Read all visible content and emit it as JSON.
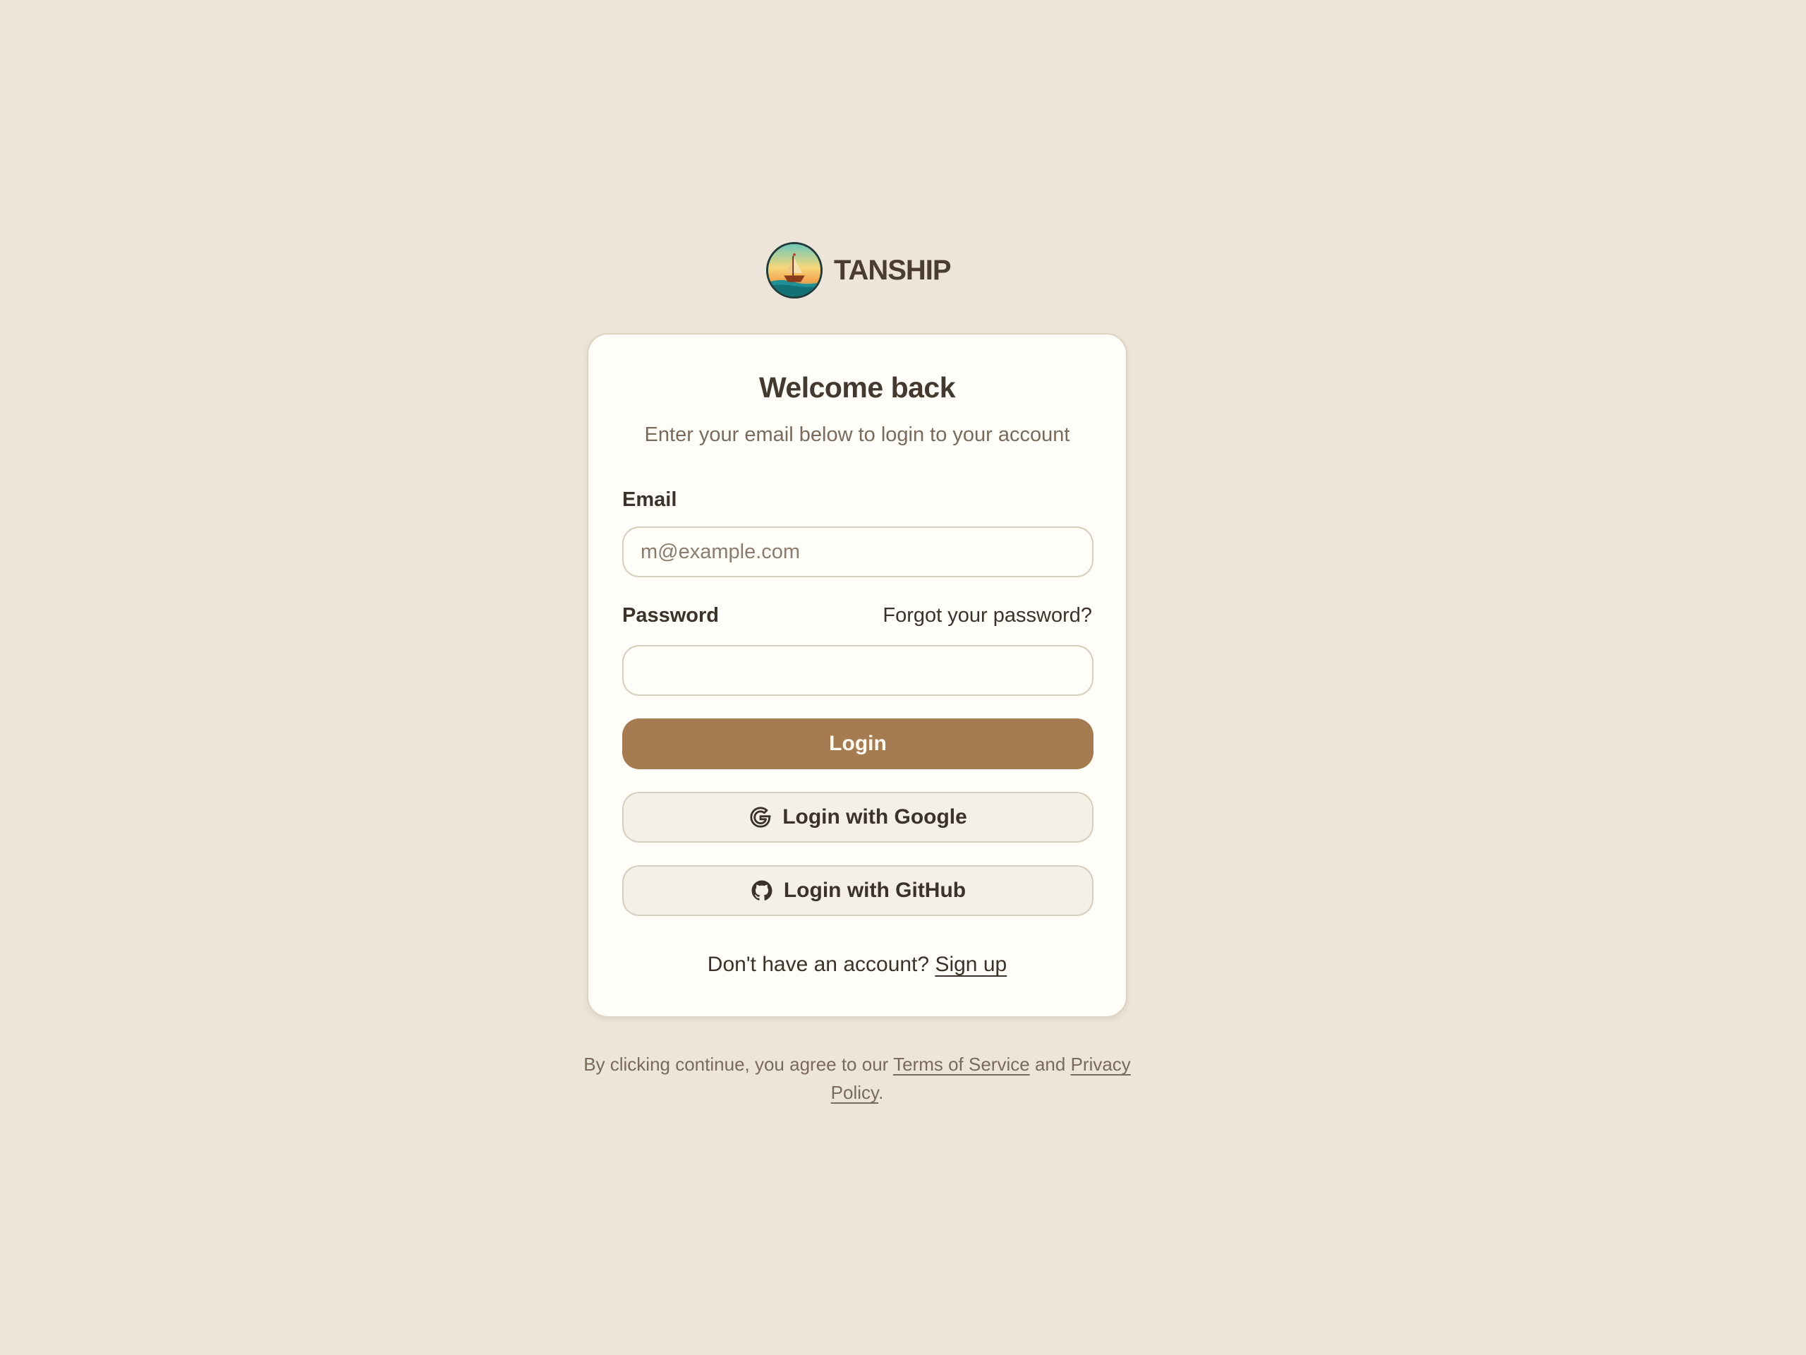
{
  "brand": {
    "name": "TANSHIP",
    "logo_icon": "ship-logo-icon"
  },
  "card": {
    "title": "Welcome back",
    "subtitle": "Enter your email below to login to your account"
  },
  "form": {
    "email_label": "Email",
    "email_placeholder": "m@example.com",
    "email_value": "",
    "password_label": "Password",
    "password_value": "",
    "forgot_link": "Forgot your password?",
    "login_button": "Login",
    "google_button": "Login with Google",
    "google_icon": "google-icon",
    "github_button": "Login with GitHub",
    "github_icon": "github-icon"
  },
  "signup": {
    "prompt": "Don't have an account?",
    "link": "Sign up"
  },
  "legal": {
    "prefix": "By clicking continue, you agree to our",
    "terms_link": "Terms of Service",
    "and": "and",
    "privacy_link": "Privacy Policy",
    "suffix": "."
  },
  "colors": {
    "background": "#ede5d9",
    "card": "#fefdf8",
    "primary": "#a57c52",
    "text": "#3b3229",
    "muted": "#7a6a5b"
  }
}
